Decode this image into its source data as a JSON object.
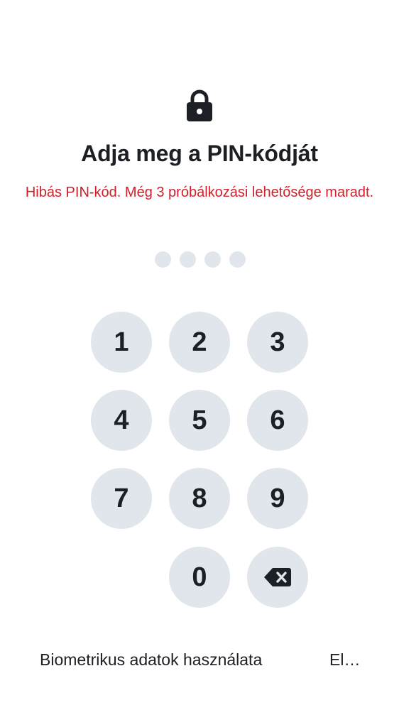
{
  "header": {
    "lock_icon": "lock-icon",
    "title": "Adja meg a PIN-kódját",
    "error_message": "Hibás PIN-kód. Még 3 próbálkozási lehetősége maradt.",
    "error_color": "#d0202c"
  },
  "pin": {
    "length": 4,
    "filled": 0
  },
  "keypad": {
    "keys": [
      "1",
      "2",
      "3",
      "4",
      "5",
      "6",
      "7",
      "8",
      "9",
      "0"
    ],
    "backspace_icon": "backspace-icon",
    "key_background": "#e1e5ec"
  },
  "footer": {
    "biometrics_label": "Biometrikus adatok használata",
    "forgot_label": "El…"
  }
}
